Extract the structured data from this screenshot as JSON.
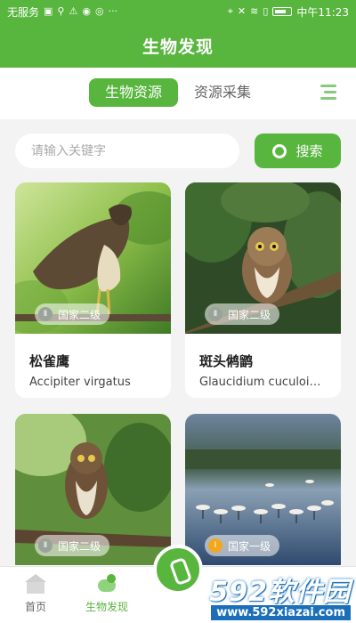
{
  "status_bar": {
    "carrier": "无服务",
    "time": "中午11:23"
  },
  "header": {
    "title": "生物发现"
  },
  "tabs": [
    {
      "label": "生物资源",
      "active": true
    },
    {
      "label": "资源采集",
      "active": false
    }
  ],
  "search": {
    "placeholder": "请输入关键字",
    "button_label": "搜索"
  },
  "cards": [
    {
      "name": "松雀鹰",
      "latin": "Accipiter virgatus",
      "badge": "国家二级"
    },
    {
      "name": "斑头鸺鹠",
      "latin": "Glaucidium cuculoides",
      "badge": "国家二级"
    },
    {
      "name": "",
      "latin": "",
      "badge": "国家二级"
    },
    {
      "name": "",
      "latin": "",
      "badge": "国家一级"
    }
  ],
  "bottom_nav": [
    {
      "label": "首页"
    },
    {
      "label": "生物发现",
      "active": true
    }
  ],
  "watermark": {
    "brand": "592软件园",
    "url": "www.592xiazai.com"
  },
  "colors": {
    "accent": "#58b53e",
    "badge_level1": "#f2a81d"
  }
}
